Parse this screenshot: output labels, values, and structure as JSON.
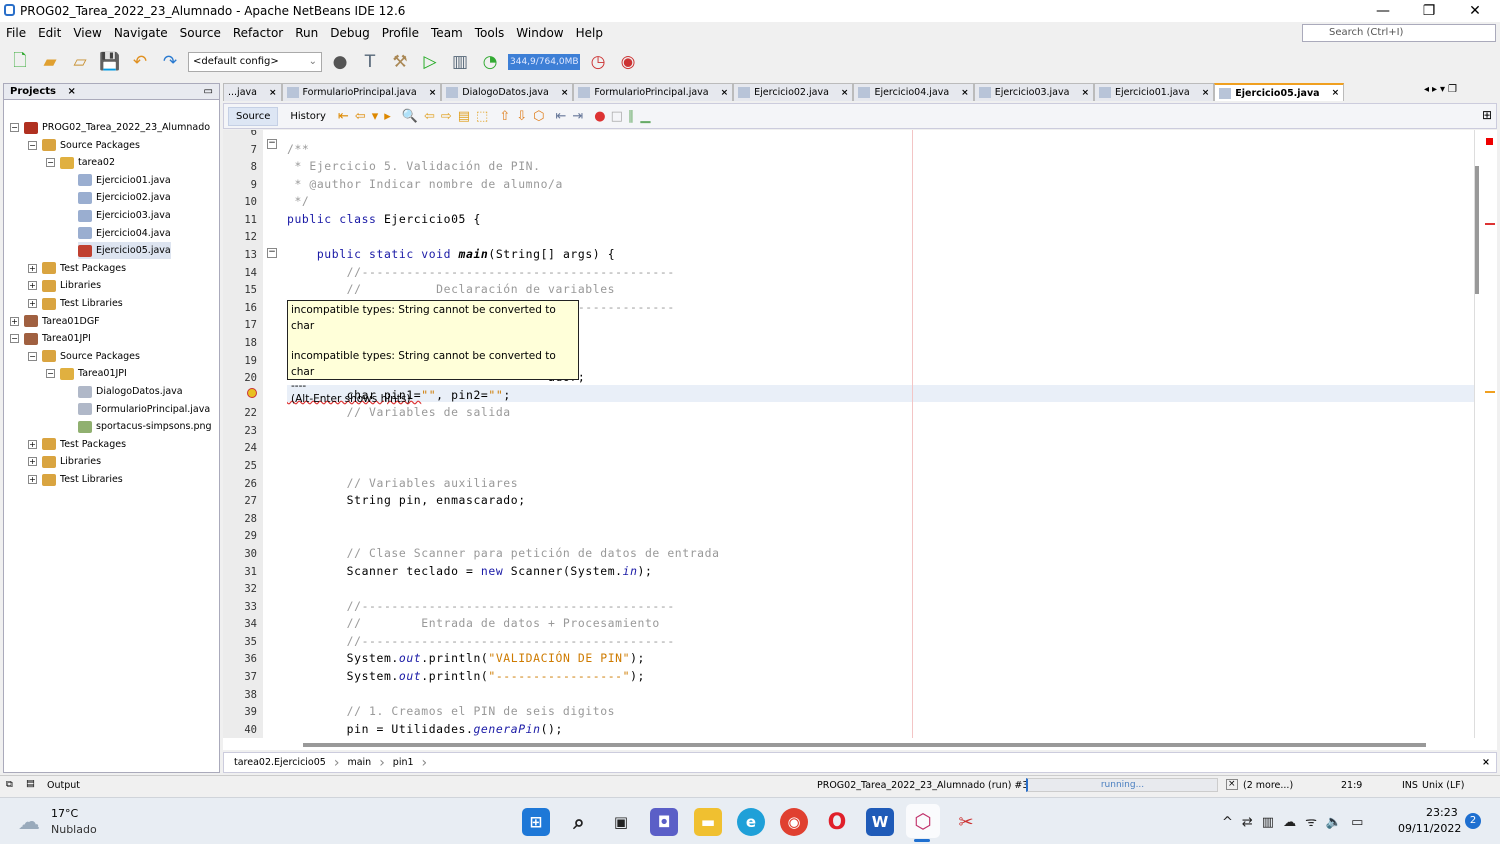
{
  "window": {
    "title": "PROG02_Tarea_2022_23_Alumnado - Apache NetBeans IDE 12.6",
    "minimize": "—",
    "restore": "❐",
    "close": "✕"
  },
  "menu": [
    "File",
    "Edit",
    "View",
    "Navigate",
    "Source",
    "Refactor",
    "Run",
    "Debug",
    "Profile",
    "Team",
    "Tools",
    "Window",
    "Help"
  ],
  "search": {
    "placeholder": "Search (Ctrl+I)"
  },
  "toolbar": {
    "config": "<default config>",
    "memory": "344,9/764,0MB"
  },
  "projects": {
    "title": "Projects",
    "items": [
      {
        "label": "PROG02_Tarea_2022_23_Alumnado",
        "level": 0,
        "toggle": "−",
        "color": "#b03020"
      },
      {
        "label": "Source Packages",
        "level": 1,
        "toggle": "−",
        "color": "#d9a440"
      },
      {
        "label": "tarea02",
        "level": 2,
        "toggle": "−",
        "color": "#e0b040"
      },
      {
        "label": "Ejercicio01.java",
        "level": 3,
        "color": "#9aaed0"
      },
      {
        "label": "Ejercicio02.java",
        "level": 3,
        "color": "#9aaed0"
      },
      {
        "label": "Ejercicio03.java",
        "level": 3,
        "color": "#9aaed0"
      },
      {
        "label": "Ejercicio04.java",
        "level": 3,
        "color": "#9aaed0"
      },
      {
        "label": "Ejercicio05.java",
        "level": 3,
        "color": "#c04030",
        "selected": true
      },
      {
        "label": "Test Packages",
        "level": 1,
        "toggle": "+",
        "color": "#d9a440"
      },
      {
        "label": "Libraries",
        "level": 1,
        "toggle": "+",
        "color": "#d9a440"
      },
      {
        "label": "Test Libraries",
        "level": 1,
        "toggle": "+",
        "color": "#d9a440"
      },
      {
        "label": "Tarea01DGF",
        "level": 0,
        "toggle": "+",
        "color": "#a06040"
      },
      {
        "label": "Tarea01JPI",
        "level": 0,
        "toggle": "−",
        "color": "#a06040"
      },
      {
        "label": "Source Packages",
        "level": 1,
        "toggle": "−",
        "color": "#d9a440"
      },
      {
        "label": "Tarea01JPI",
        "level": 2,
        "toggle": "−",
        "color": "#e0b040"
      },
      {
        "label": "DialogoDatos.java",
        "level": 3,
        "color": "#b0b8c8"
      },
      {
        "label": "FormularioPrincipal.java",
        "level": 3,
        "color": "#b0b8c8"
      },
      {
        "label": "sportacus-simpsons.png",
        "level": 3,
        "color": "#90b070"
      },
      {
        "label": "Test Packages",
        "level": 1,
        "toggle": "+",
        "color": "#d9a440"
      },
      {
        "label": "Libraries",
        "level": 1,
        "toggle": "+",
        "color": "#d9a440"
      },
      {
        "label": "Test Libraries",
        "level": 1,
        "toggle": "+",
        "color": "#d9a440"
      }
    ]
  },
  "tabs": [
    {
      "label": "...java"
    },
    {
      "label": "FormularioPrincipal.java"
    },
    {
      "label": "DialogoDatos.java"
    },
    {
      "label": "FormularioPrincipal.java"
    },
    {
      "label": "Ejercicio02.java"
    },
    {
      "label": "Ejercicio04.java"
    },
    {
      "label": "Ejercicio03.java"
    },
    {
      "label": "Ejercicio01.java"
    },
    {
      "label": "Ejercicio05.java",
      "active": true
    }
  ],
  "editor_toolbar": {
    "source": "Source",
    "history": "History"
  },
  "code": [
    {
      "n": "6",
      "t": []
    },
    {
      "n": "7",
      "t": [
        [
          "/**",
          "cm"
        ]
      ]
    },
    {
      "n": "8",
      "t": [
        [
          " * Ejercicio 5. Validación de PIN.",
          "cm"
        ]
      ]
    },
    {
      "n": "9",
      "t": [
        [
          " * @author Indicar nombre de alumno/a",
          "cm"
        ]
      ]
    },
    {
      "n": "10",
      "t": [
        [
          " */",
          "cm"
        ]
      ]
    },
    {
      "n": "11",
      "t": [
        [
          "public class ",
          "kw"
        ],
        [
          "Ejercicio05 {",
          ""
        ]
      ]
    },
    {
      "n": "12",
      "t": []
    },
    {
      "n": "13",
      "t": [
        [
          "    public static void ",
          "kw"
        ],
        [
          "main",
          "bd"
        ],
        [
          "(String[] args) {",
          ""
        ]
      ]
    },
    {
      "n": "14",
      "t": [
        [
          "        //------------------------------------------",
          "cm"
        ]
      ]
    },
    {
      "n": "15",
      "t": [
        [
          "        //          Declaración de variables",
          "cm"
        ]
      ]
    },
    {
      "n": "16",
      "t": [
        [
          "        //------------------------------------------",
          "cm"
        ]
      ]
    },
    {
      "n": "17",
      "t": []
    },
    {
      "n": "18",
      "t": []
    },
    {
      "n": "19",
      "t": []
    },
    {
      "n": "20",
      "t": [
        [
          "                                   ador;",
          ""
        ]
      ]
    },
    {
      "n": "",
      "t": [
        [
          "        char pin1=",
          "u"
        ],
        [
          "\"\"",
          "str"
        ],
        [
          ", pin2=",
          ""
        ],
        [
          "\"\"",
          "str"
        ],
        [
          ";",
          ""
        ]
      ]
    },
    {
      "n": "22",
      "t": [
        [
          "        // Variables de salida",
          "cm"
        ]
      ]
    },
    {
      "n": "23",
      "t": []
    },
    {
      "n": "24",
      "t": []
    },
    {
      "n": "25",
      "t": []
    },
    {
      "n": "26",
      "t": [
        [
          "        // Variables auxiliares",
          "cm"
        ]
      ]
    },
    {
      "n": "27",
      "t": [
        [
          "        String pin, enmascarado;",
          ""
        ]
      ]
    },
    {
      "n": "28",
      "t": []
    },
    {
      "n": "29",
      "t": []
    },
    {
      "n": "30",
      "t": [
        [
          "        // Clase Scanner para petición de datos de entrada",
          "cm"
        ]
      ]
    },
    {
      "n": "31",
      "t": [
        [
          "        Scanner teclado = ",
          ""
        ],
        [
          "new ",
          "kw"
        ],
        [
          "Scanner(System.",
          ""
        ],
        [
          "in",
          "it"
        ],
        [
          ");",
          ""
        ]
      ]
    },
    {
      "n": "32",
      "t": []
    },
    {
      "n": "33",
      "t": [
        [
          "        //------------------------------------------",
          "cm"
        ]
      ]
    },
    {
      "n": "34",
      "t": [
        [
          "        //        Entrada de datos + Procesamiento",
          "cm"
        ]
      ]
    },
    {
      "n": "35",
      "t": [
        [
          "        //------------------------------------------",
          "cm"
        ]
      ]
    },
    {
      "n": "36",
      "t": [
        [
          "        System.",
          ""
        ],
        [
          "out",
          "it"
        ],
        [
          ".println(",
          ""
        ],
        [
          "\"VALIDACIÓN DE PIN\"",
          "str"
        ],
        [
          ");",
          ""
        ]
      ]
    },
    {
      "n": "37",
      "t": [
        [
          "        System.",
          ""
        ],
        [
          "out",
          "it"
        ],
        [
          ".println(",
          ""
        ],
        [
          "\"-----------------\"",
          "str"
        ],
        [
          ");",
          ""
        ]
      ]
    },
    {
      "n": "38",
      "t": []
    },
    {
      "n": "39",
      "t": [
        [
          "        // 1. Creamos el PIN de seis digitos",
          "cm"
        ]
      ]
    },
    {
      "n": "40",
      "t": [
        [
          "        pin = Utilidades.",
          ""
        ],
        [
          "generaPin",
          "it"
        ],
        [
          "();",
          ""
        ]
      ]
    }
  ],
  "tooltip": {
    "line1": "incompatible types: String cannot be converted to char",
    "line2": "incompatible types: String cannot be converted to char",
    "sep": "----",
    "hint": "(Alt-Enter shows hints)"
  },
  "breadcrumb": [
    "tarea02.Ejercicio05",
    "main",
    "pin1"
  ],
  "status": {
    "output": "Output",
    "task": "PROG02_Tarea_2022_23_Alumnado (run) #3",
    "progress": "running...",
    "more": "(2 more...)",
    "position": "21:9",
    "mode": "INS",
    "eol": "Unix (LF)"
  },
  "taskbar": {
    "temp": "17°C",
    "weather": "Nublado",
    "time": "23:23",
    "date": "09/11/2022",
    "notifications": "2"
  }
}
